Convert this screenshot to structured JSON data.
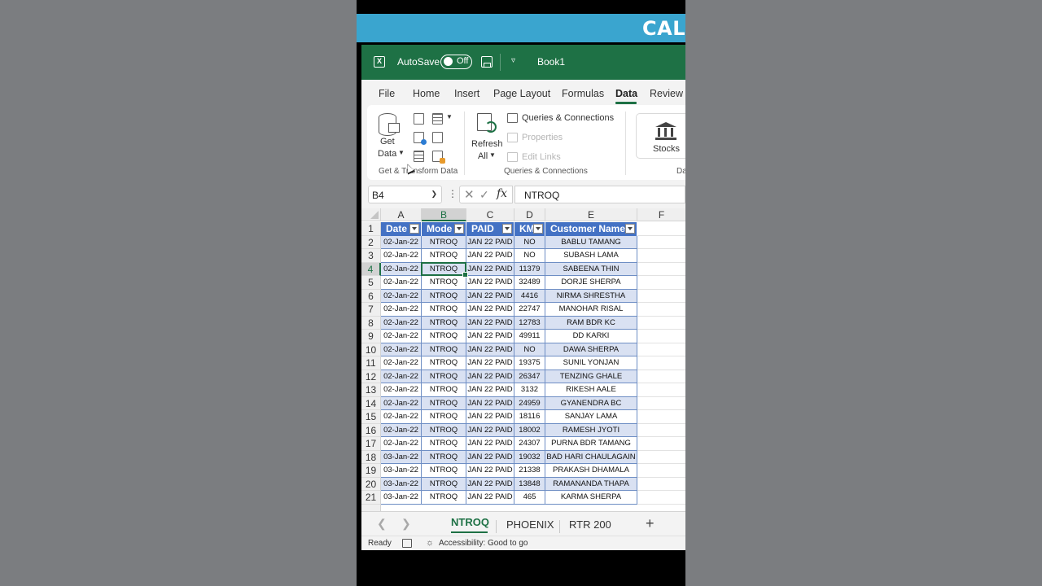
{
  "banner": {
    "text": "CAL"
  },
  "titlebar": {
    "app_icon": "excel-icon",
    "autosave_label": "AutoSave",
    "autosave_state": "Off",
    "book_title": "Book1"
  },
  "tabs": [
    "File",
    "Home",
    "Insert",
    "Page Layout",
    "Formulas",
    "Data",
    "Review"
  ],
  "active_tab": "Data",
  "ribbon": {
    "get_data": {
      "line1": "Get",
      "line2": "Data"
    },
    "group1_label": "Get & Transform Data",
    "refresh": {
      "line1": "Refresh",
      "line2": "All"
    },
    "queries_connections": "Queries & Connections",
    "properties": "Properties",
    "edit_links": "Edit Links",
    "group2_label": "Queries & Connections",
    "stocks": "Stocks",
    "group3_label": "Da"
  },
  "formula_bar": {
    "name_box": "B4",
    "cancel_icon": "close-icon",
    "enter_icon": "check-icon",
    "fx": "fx",
    "value": "NTROQ"
  },
  "columns": [
    "A",
    "B",
    "C",
    "D",
    "E",
    "F"
  ],
  "table_headers": [
    "Date",
    "Mode",
    "PAID",
    "KM",
    "Customer Name"
  ],
  "rows": [
    {
      "n": "2",
      "cells": [
        "02-Jan-22",
        "NTROQ",
        "JAN 22 PAID",
        "NO",
        "BABLU TAMANG"
      ]
    },
    {
      "n": "3",
      "cells": [
        "02-Jan-22",
        "NTROQ",
        "JAN 22 PAID",
        "NO",
        "SUBASH LAMA"
      ]
    },
    {
      "n": "4",
      "cells": [
        "02-Jan-22",
        "NTROQ",
        "JAN 22 PAID",
        "11379",
        "SABEENA THIN"
      ]
    },
    {
      "n": "5",
      "cells": [
        "02-Jan-22",
        "NTROQ",
        "JAN 22 PAID",
        "32489",
        "DORJE SHERPA"
      ]
    },
    {
      "n": "6",
      "cells": [
        "02-Jan-22",
        "NTROQ",
        "JAN 22 PAID",
        "4416",
        "NIRMA SHRESTHA"
      ]
    },
    {
      "n": "7",
      "cells": [
        "02-Jan-22",
        "NTROQ",
        "JAN 22 PAID",
        "22747",
        "MANOHAR RISAL"
      ]
    },
    {
      "n": "8",
      "cells": [
        "02-Jan-22",
        "NTROQ",
        "JAN 22 PAID",
        "12783",
        "RAM BDR KC"
      ]
    },
    {
      "n": "9",
      "cells": [
        "02-Jan-22",
        "NTROQ",
        "JAN 22 PAID",
        "49911",
        "DD KARKI"
      ]
    },
    {
      "n": "10",
      "cells": [
        "02-Jan-22",
        "NTROQ",
        "JAN 22 PAID",
        "NO",
        "DAWA SHERPA"
      ]
    },
    {
      "n": "11",
      "cells": [
        "02-Jan-22",
        "NTROQ",
        "JAN 22 PAID",
        "19375",
        "SUNIL YONJAN"
      ]
    },
    {
      "n": "12",
      "cells": [
        "02-Jan-22",
        "NTROQ",
        "JAN 22 PAID",
        "26347",
        "TENZING GHALE"
      ]
    },
    {
      "n": "13",
      "cells": [
        "02-Jan-22",
        "NTROQ",
        "JAN 22 PAID",
        "3132",
        "RIKESH AALE"
      ]
    },
    {
      "n": "14",
      "cells": [
        "02-Jan-22",
        "NTROQ",
        "JAN 22 PAID",
        "24959",
        "GYANENDRA BC"
      ]
    },
    {
      "n": "15",
      "cells": [
        "02-Jan-22",
        "NTROQ",
        "JAN 22 PAID",
        "18116",
        "SANJAY LAMA"
      ]
    },
    {
      "n": "16",
      "cells": [
        "02-Jan-22",
        "NTROQ",
        "JAN 22 PAID",
        "18002",
        "RAMESH JYOTI"
      ]
    },
    {
      "n": "17",
      "cells": [
        "02-Jan-22",
        "NTROQ",
        "JAN 22 PAID",
        "24307",
        "PURNA BDR TAMANG"
      ]
    },
    {
      "n": "18",
      "cells": [
        "03-Jan-22",
        "NTROQ",
        "JAN 22 PAID",
        "19032",
        "BAD HARI CHAULAGAIN"
      ]
    },
    {
      "n": "19",
      "cells": [
        "03-Jan-22",
        "NTROQ",
        "JAN 22 PAID",
        "21338",
        "PRAKASH DHAMALA"
      ]
    },
    {
      "n": "20",
      "cells": [
        "03-Jan-22",
        "NTROQ",
        "JAN 22 PAID",
        "13848",
        "RAMANANDA THAPA"
      ]
    },
    {
      "n": "21",
      "cells": [
        "03-Jan-22",
        "NTROQ",
        "JAN 22 PAID",
        "465",
        "KARMA SHERPA"
      ]
    }
  ],
  "header_row_number": "1",
  "sheets": [
    "NTROQ",
    "PHOENIX",
    "RTR 200"
  ],
  "active_sheet": "NTROQ",
  "add_sheet": "+",
  "status": {
    "ready": "Ready",
    "accessibility": "Accessibility: Good to go"
  }
}
